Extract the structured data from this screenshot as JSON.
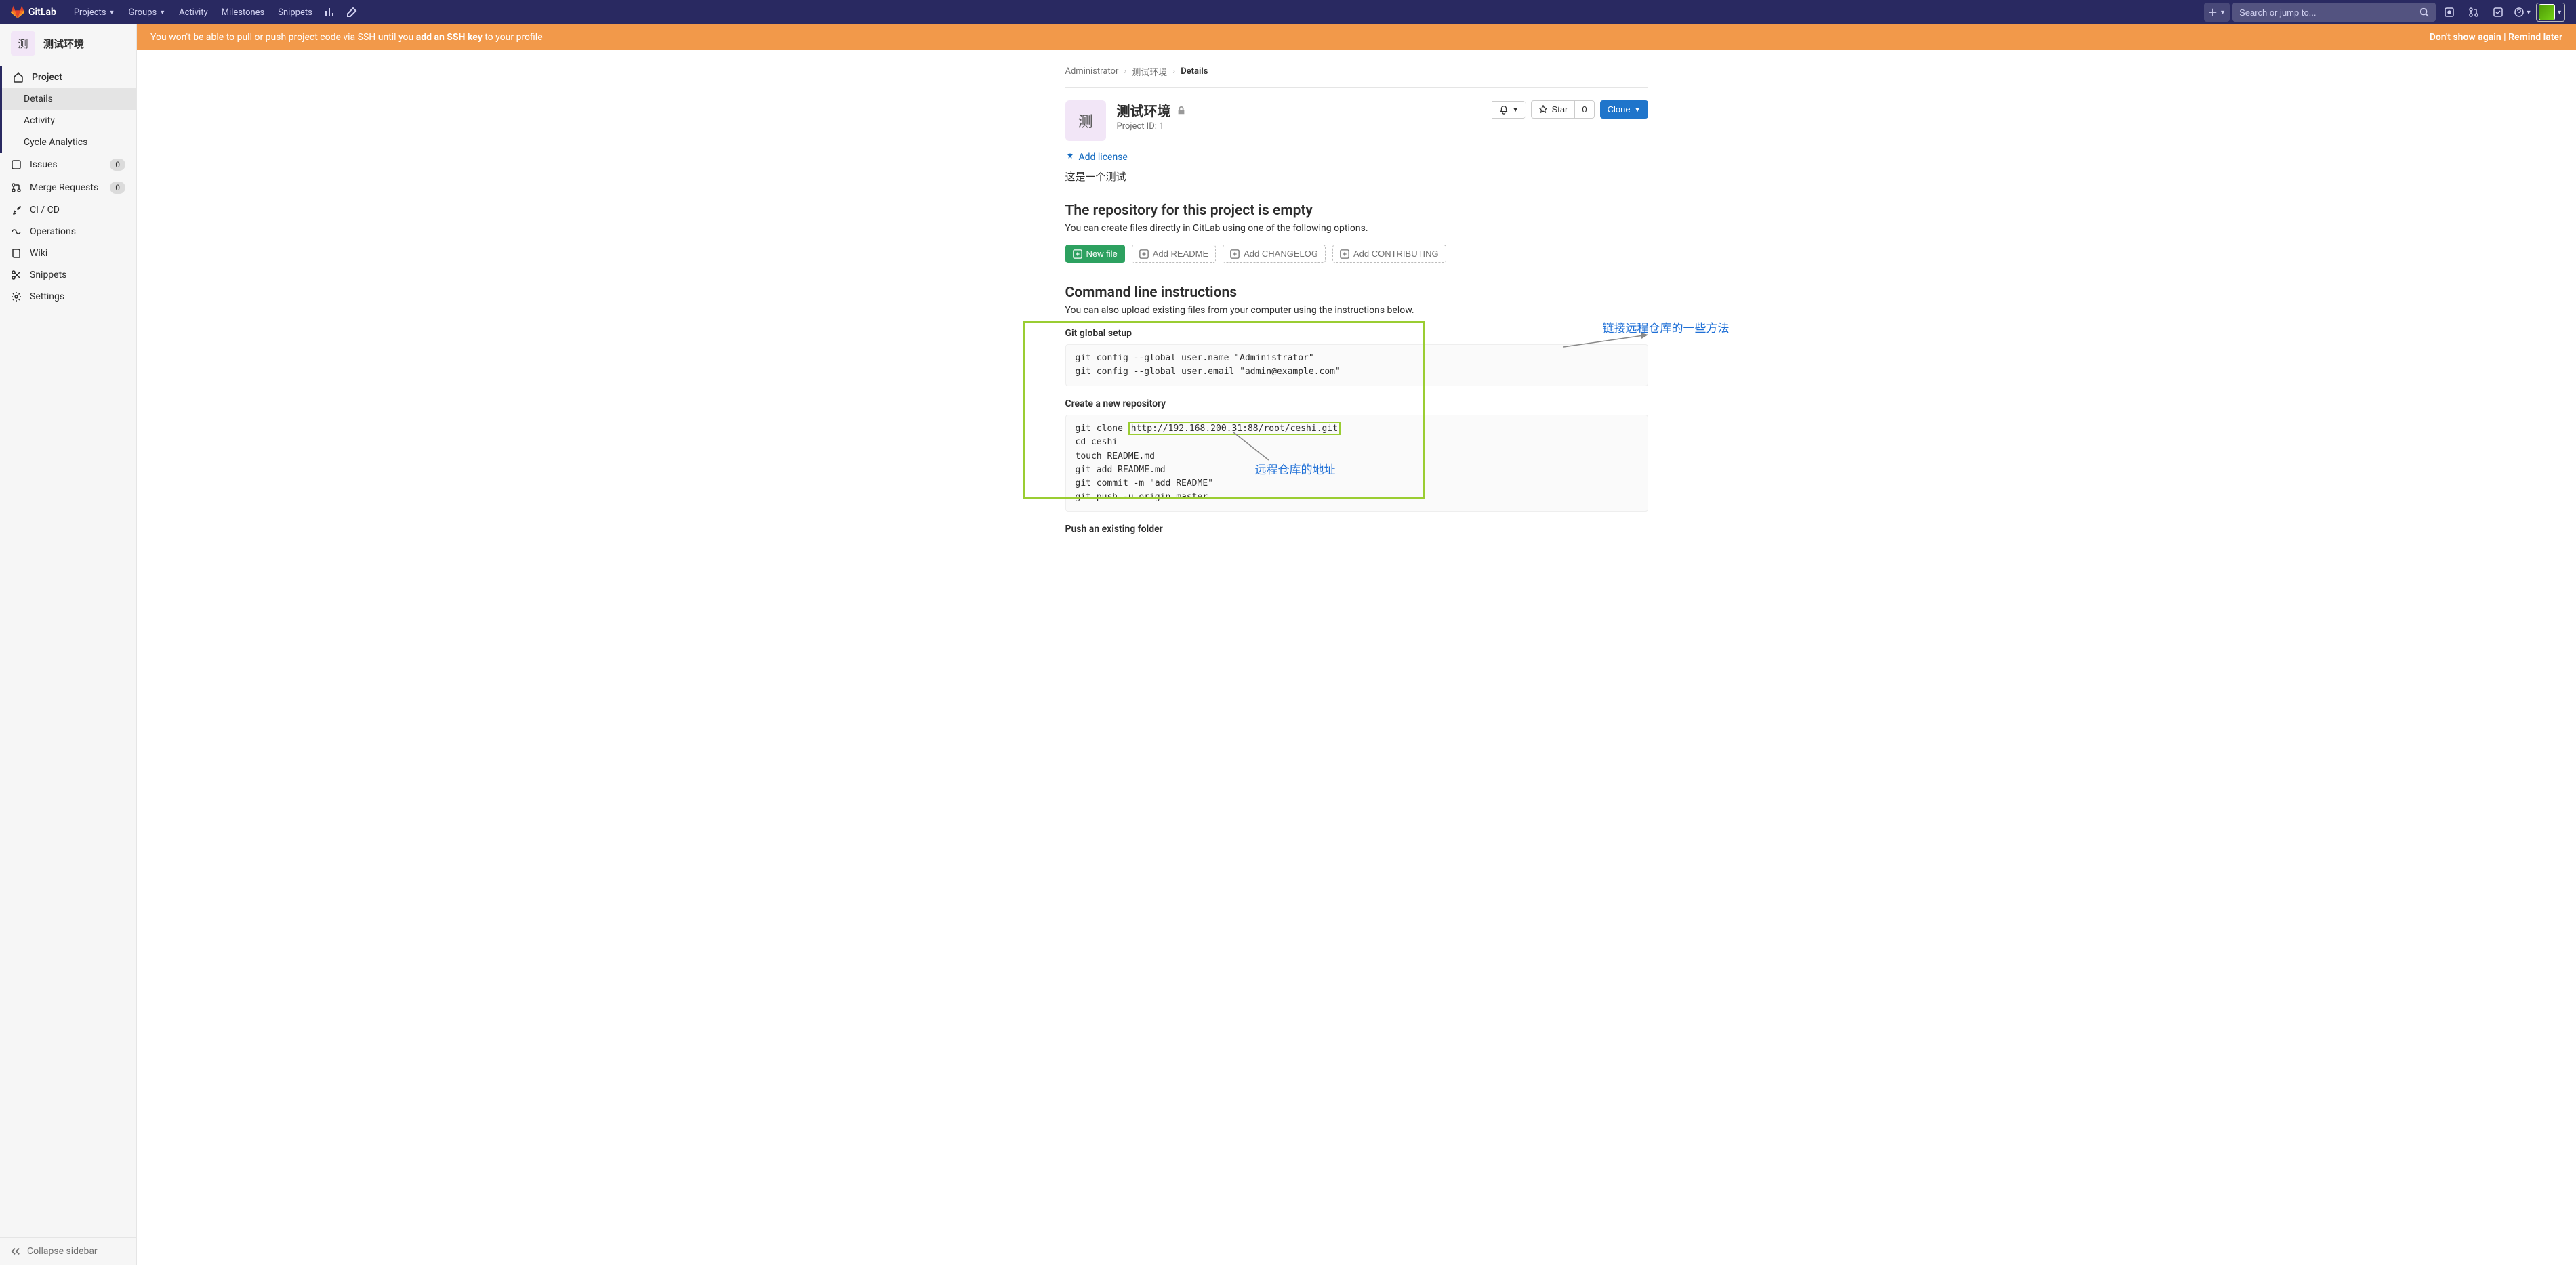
{
  "topnav": {
    "brand": "GitLab",
    "items": [
      "Projects",
      "Groups",
      "Activity",
      "Milestones",
      "Snippets"
    ],
    "search_placeholder": "Search or jump to..."
  },
  "sidebar": {
    "avatar_letter": "测",
    "project_name": "测试环境",
    "project": {
      "label": "Project",
      "sub": [
        "Details",
        "Activity",
        "Cycle Analytics"
      ]
    },
    "items": [
      {
        "label": "Issues",
        "badge": "0"
      },
      {
        "label": "Merge Requests",
        "badge": "0"
      },
      {
        "label": "CI / CD"
      },
      {
        "label": "Operations"
      },
      {
        "label": "Wiki"
      },
      {
        "label": "Snippets"
      },
      {
        "label": "Settings"
      }
    ],
    "collapse": "Collapse sidebar"
  },
  "alert": {
    "prefix": "You won't be able to pull or push project code via SSH until you ",
    "link": "add an SSH key",
    "suffix": " to your profile",
    "dismiss": "Don't show again",
    "sep": " | ",
    "remind": "Remind later"
  },
  "crumbs": {
    "a": "Administrator",
    "b": "测试环境",
    "c": "Details"
  },
  "project": {
    "avatar_letter": "测",
    "title": "测试环境",
    "id_label": "Project ID: 1",
    "star": "Star",
    "star_count": "0",
    "clone": "Clone",
    "add_license": "Add license",
    "description": "这是一个测试"
  },
  "empty": {
    "heading": "The repository for this project is empty",
    "sub": "You can create files directly in GitLab using one of the following options.",
    "new_file": "New file",
    "add_readme": "Add README",
    "add_changelog": "Add CHANGELOG",
    "add_contributing": "Add CONTRIBUTING"
  },
  "cli": {
    "heading": "Command line instructions",
    "sub": "You can also upload existing files from your computer using the instructions below.",
    "setup_title": "Git global setup",
    "setup_code": "git config --global user.name \"Administrator\"\ngit config --global user.email \"admin@example.com\"",
    "new_repo_title": "Create a new repository",
    "clone_prefix": "git clone ",
    "clone_url": "http://192.168.200.31:88/root/ceshi.git",
    "new_repo_rest": "cd ceshi\ntouch README.md\ngit add README.md\ngit commit -m \"add README\"\ngit push -u origin master",
    "push_title": "Push an existing folder"
  },
  "annotations": {
    "methods": "链接远程仓库的一些方法",
    "address": "远程仓库的地址"
  }
}
